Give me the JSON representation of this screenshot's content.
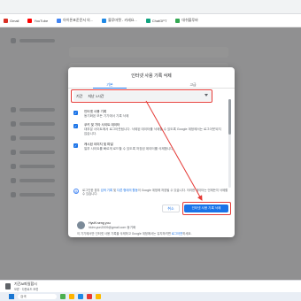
{
  "bookmarks": [
    {
      "label": "Gmail",
      "icon": "gmail-icon",
      "color": "#d93025"
    },
    {
      "label": "YouTube",
      "icon": "youtube-icon",
      "color": "#ff0000"
    },
    {
      "label": "아이폰표준문서 의...",
      "icon": "doc-icon",
      "color": "#4285f4"
    },
    {
      "label": "블루마켓 - 카세요...",
      "icon": "shop-icon",
      "color": "#1e88e5"
    },
    {
      "label": "ChatGPT",
      "icon": "chatgpt-icon",
      "color": "#10a37f"
    },
    {
      "label": "대쉬블루바",
      "icon": "bookmark-icon",
      "color": "#34a853"
    }
  ],
  "dialog": {
    "title": "인터넷 사용 기록 삭제",
    "tabs": [
      "기본",
      "고급"
    ],
    "period_label": "기간",
    "period_value": "지난 1시간",
    "options": [
      {
        "title": "인터넷 사용 기록",
        "desc": "동기화된 모든 기기에서 기록 삭제"
      },
      {
        "title": "쿠키 및 기타 사이트 데이터",
        "desc": "대부분 사이트에서 로그아웃됩니다. 삭제된 데이터를 삭제할 수 있도록 Google 계정에서는 로그아웃되지 않습니다."
      },
      {
        "title": "캐시된 이미지 및 파일",
        "desc": "일부 사이트를 빠르게 로드할 수 있도록 저장된 데이터를 삭제합니다."
      }
    ],
    "info_text_1": "로그인한 경우",
    "info_link_1": "검색 기록",
    "info_text_2": "및",
    "info_link_2": "다른 형태의 활동",
    "info_text_3": "이 Google 계정에 저장될 수 있습니다. 이러한 데이터는 언제든지 삭제할 수 있습니다.",
    "cancel_label": "취소",
    "delete_label": "인터넷 사용 기록 삭제",
    "profile_name": "HyuN seng you",
    "profile_email": "hkim.yun2009@gmail.com 동기화",
    "sync_note_1": "이 기기에서만 인터넷 사용 기록을 삭제하고 Google 계정에서는 유지하려면",
    "sync_note_link": "로그아웃",
    "sync_note_2": "하세요."
  },
  "download": {
    "filename": "기간AI파일합시",
    "sub": "보류 · 다운로드 보류"
  },
  "taskbar": {
    "search_placeholder": "검색"
  },
  "colors": {
    "accent": "#1a73e8",
    "annotation": "#e53935"
  }
}
